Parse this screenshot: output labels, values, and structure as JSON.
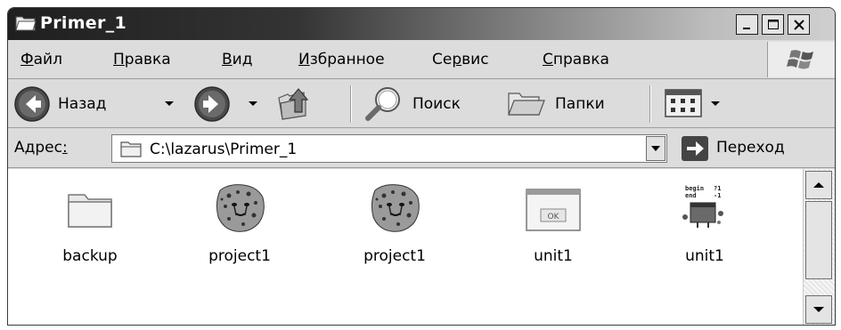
{
  "window": {
    "title": "Primer_1"
  },
  "menu": {
    "file": {
      "accel": "Ф",
      "rest": "айл"
    },
    "edit": {
      "accel": "П",
      "rest": "равка"
    },
    "view": {
      "accel": "В",
      "rest": "ид"
    },
    "favorites": {
      "accel": "И",
      "rest": "збранное"
    },
    "tools": {
      "pre": "Се",
      "accel": "р",
      "rest": "вис"
    },
    "help": {
      "accel": "С",
      "rest": "правка"
    }
  },
  "toolbar": {
    "back_label": "Назад",
    "search_label": "Поиск",
    "folders_label": "Папки"
  },
  "address": {
    "label_pre": "Адрес",
    "label_accel": ":",
    "value": "C:\\lazarus\\Primer_1",
    "go_label": "Переход"
  },
  "files": [
    {
      "name": "backup",
      "icon": "folder-icon"
    },
    {
      "name": "project1",
      "icon": "cheetah-icon"
    },
    {
      "name": "project1",
      "icon": "cheetah-icon"
    },
    {
      "name": "unit1",
      "icon": "form-icon"
    },
    {
      "name": "unit1",
      "icon": "source-unit-icon"
    }
  ],
  "form_icon_text": "OK",
  "colors": {
    "titlebar_dark": "#1f1f1f",
    "window_face": "#dcdcdc",
    "content_bg": "#ffffff"
  }
}
